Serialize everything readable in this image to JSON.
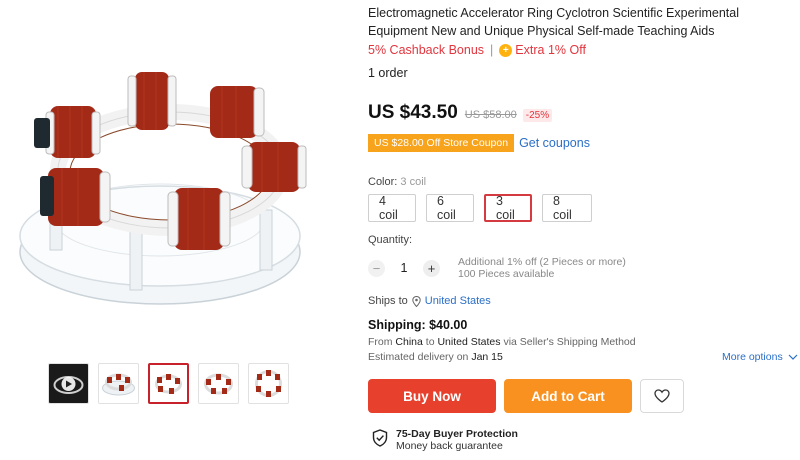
{
  "product": {
    "title": "Electromagnetic Accelerator Ring Cyclotron Scientific Experimental Equipment New and Unique Physical Self-made Teaching Aids",
    "cashback": "5% Cashback Bonus",
    "promo_separator": "|",
    "extra_off": "Extra 1% Off",
    "orders": "1 order",
    "price": "US $43.50",
    "old_price": "US $58.00",
    "discount": "-25%",
    "coupon": "US $28.00 Off Store Coupon",
    "get_coupons": "Get coupons"
  },
  "color": {
    "label": "Color:",
    "selected": "3 coil",
    "options": [
      "4 coil",
      "6 coil",
      "3 coil",
      "8 coil"
    ],
    "selected_index": 2
  },
  "quantity": {
    "label": "Quantity:",
    "minus": "−",
    "plus": "+",
    "value": "1",
    "note_line1": "Additional 1% off (2 Pieces or more)",
    "note_line2": "100 Pieces available"
  },
  "shipping": {
    "ships_to_label": "Ships to",
    "ships_to_country": "United States",
    "cost": "Shipping: $40.00",
    "from_prefix": "From",
    "from_country": "China",
    "to_word": "to",
    "to_country": "United States",
    "via": "via Seller's Shipping Method",
    "delivery_label": "Estimated delivery on",
    "delivery_date": "Jan 15",
    "more_options": "More options"
  },
  "actions": {
    "buy_now": "Buy Now",
    "add_to_cart": "Add to Cart"
  },
  "protection": {
    "title": "75-Day Buyer Protection",
    "subtitle": "Money back guarantee"
  },
  "gallery": {
    "thumbnail_count": 5,
    "active_thumbnail": 2
  },
  "colors": {
    "buy_now": "#e7412d",
    "add_to_cart": "#f8911f",
    "coupon": "#f7a31c",
    "link": "#2b6fc8",
    "accent_red": "#e2353d"
  }
}
